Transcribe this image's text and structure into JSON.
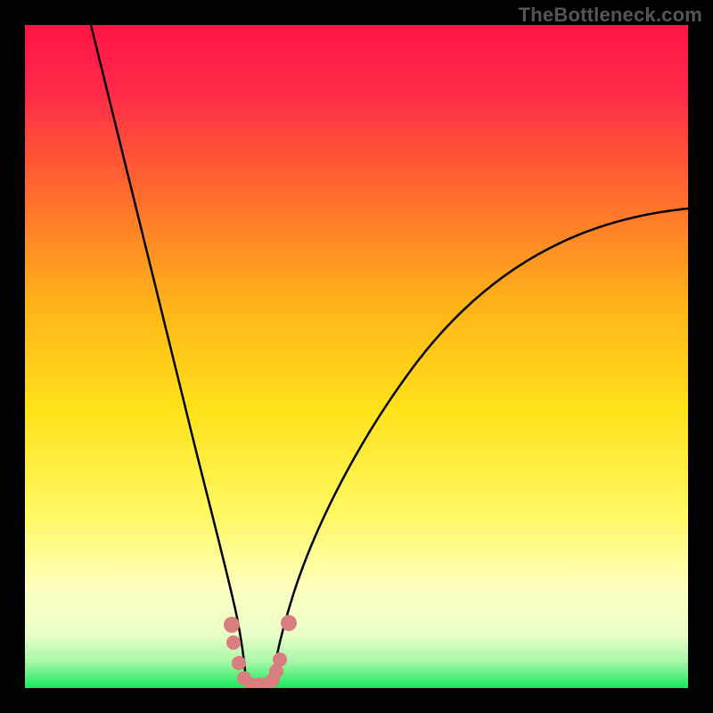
{
  "watermark": "TheBottleneck.com",
  "colors": {
    "accent_dot": "#d97e7e",
    "curve": "#000000",
    "frame": "#000000",
    "gradient_top": "#ff1a4d",
    "gradient_mid_upper": "#ff8a1a",
    "gradient_mid": "#ffe21a",
    "gradient_lower": "#ffffb3",
    "gradient_bottom": "#1fe868"
  },
  "chart_data": {
    "type": "line",
    "title": "",
    "xlabel": "",
    "ylabel": "",
    "xlim": [
      0,
      100
    ],
    "ylim": [
      0,
      100
    ],
    "grid": false,
    "legend": false,
    "series": [
      {
        "name": "left-curve",
        "x": [
          10,
          12,
          15,
          18,
          21,
          24,
          26.5,
          28.5,
          30,
          31.2,
          32.2,
          33
        ],
        "y": [
          100,
          92,
          81,
          67,
          52,
          36,
          23,
          14,
          8,
          4,
          2,
          0.7
        ]
      },
      {
        "name": "right-curve",
        "x": [
          37,
          38.5,
          41,
          44,
          48,
          53,
          59,
          66,
          74,
          83,
          92,
          100
        ],
        "y": [
          0.7,
          2.5,
          6,
          11,
          18,
          27,
          37,
          47,
          56,
          63,
          68,
          72
        ]
      },
      {
        "name": "bottom-dots",
        "style": "scatter",
        "points": [
          {
            "x": 31.2,
            "y": 9.5
          },
          {
            "x": 31.5,
            "y": 6.8
          },
          {
            "x": 32.2,
            "y": 3.8
          },
          {
            "x": 33.0,
            "y": 1.4
          },
          {
            "x": 34.0,
            "y": 0.6
          },
          {
            "x": 35.2,
            "y": 0.5
          },
          {
            "x": 36.3,
            "y": 0.6
          },
          {
            "x": 37.2,
            "y": 1.2
          },
          {
            "x": 37.8,
            "y": 2.5
          },
          {
            "x": 38.3,
            "y": 4.2
          },
          {
            "x": 39.7,
            "y": 9.8
          }
        ]
      }
    ]
  }
}
